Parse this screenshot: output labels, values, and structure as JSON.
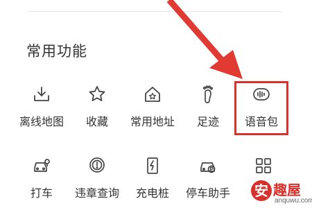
{
  "section": {
    "title": "常用功能"
  },
  "tools_row1": [
    {
      "label": "离线地图",
      "icon": "download-tray-icon"
    },
    {
      "label": "收藏",
      "icon": "star-icon"
    },
    {
      "label": "常用地址",
      "icon": "home-star-icon"
    },
    {
      "label": "足迹",
      "icon": "footprint-icon"
    },
    {
      "label": "语音包",
      "icon": "voice-wave-icon"
    }
  ],
  "tools_row2": [
    {
      "label": "打车",
      "icon": "taxi-icon"
    },
    {
      "label": "违章查询",
      "icon": "violation-search-icon"
    },
    {
      "label": "充电桩",
      "icon": "charging-pile-icon"
    },
    {
      "label": "停车助手",
      "icon": "parking-car-icon"
    },
    {
      "label": "",
      "icon": "grid-more-icon"
    }
  ],
  "annotation": {
    "highlighted_item": "语音包",
    "color": "#d8312c"
  },
  "watermark": {
    "glyph": "安",
    "name": "趣屋",
    "url": "anquwu.com"
  }
}
